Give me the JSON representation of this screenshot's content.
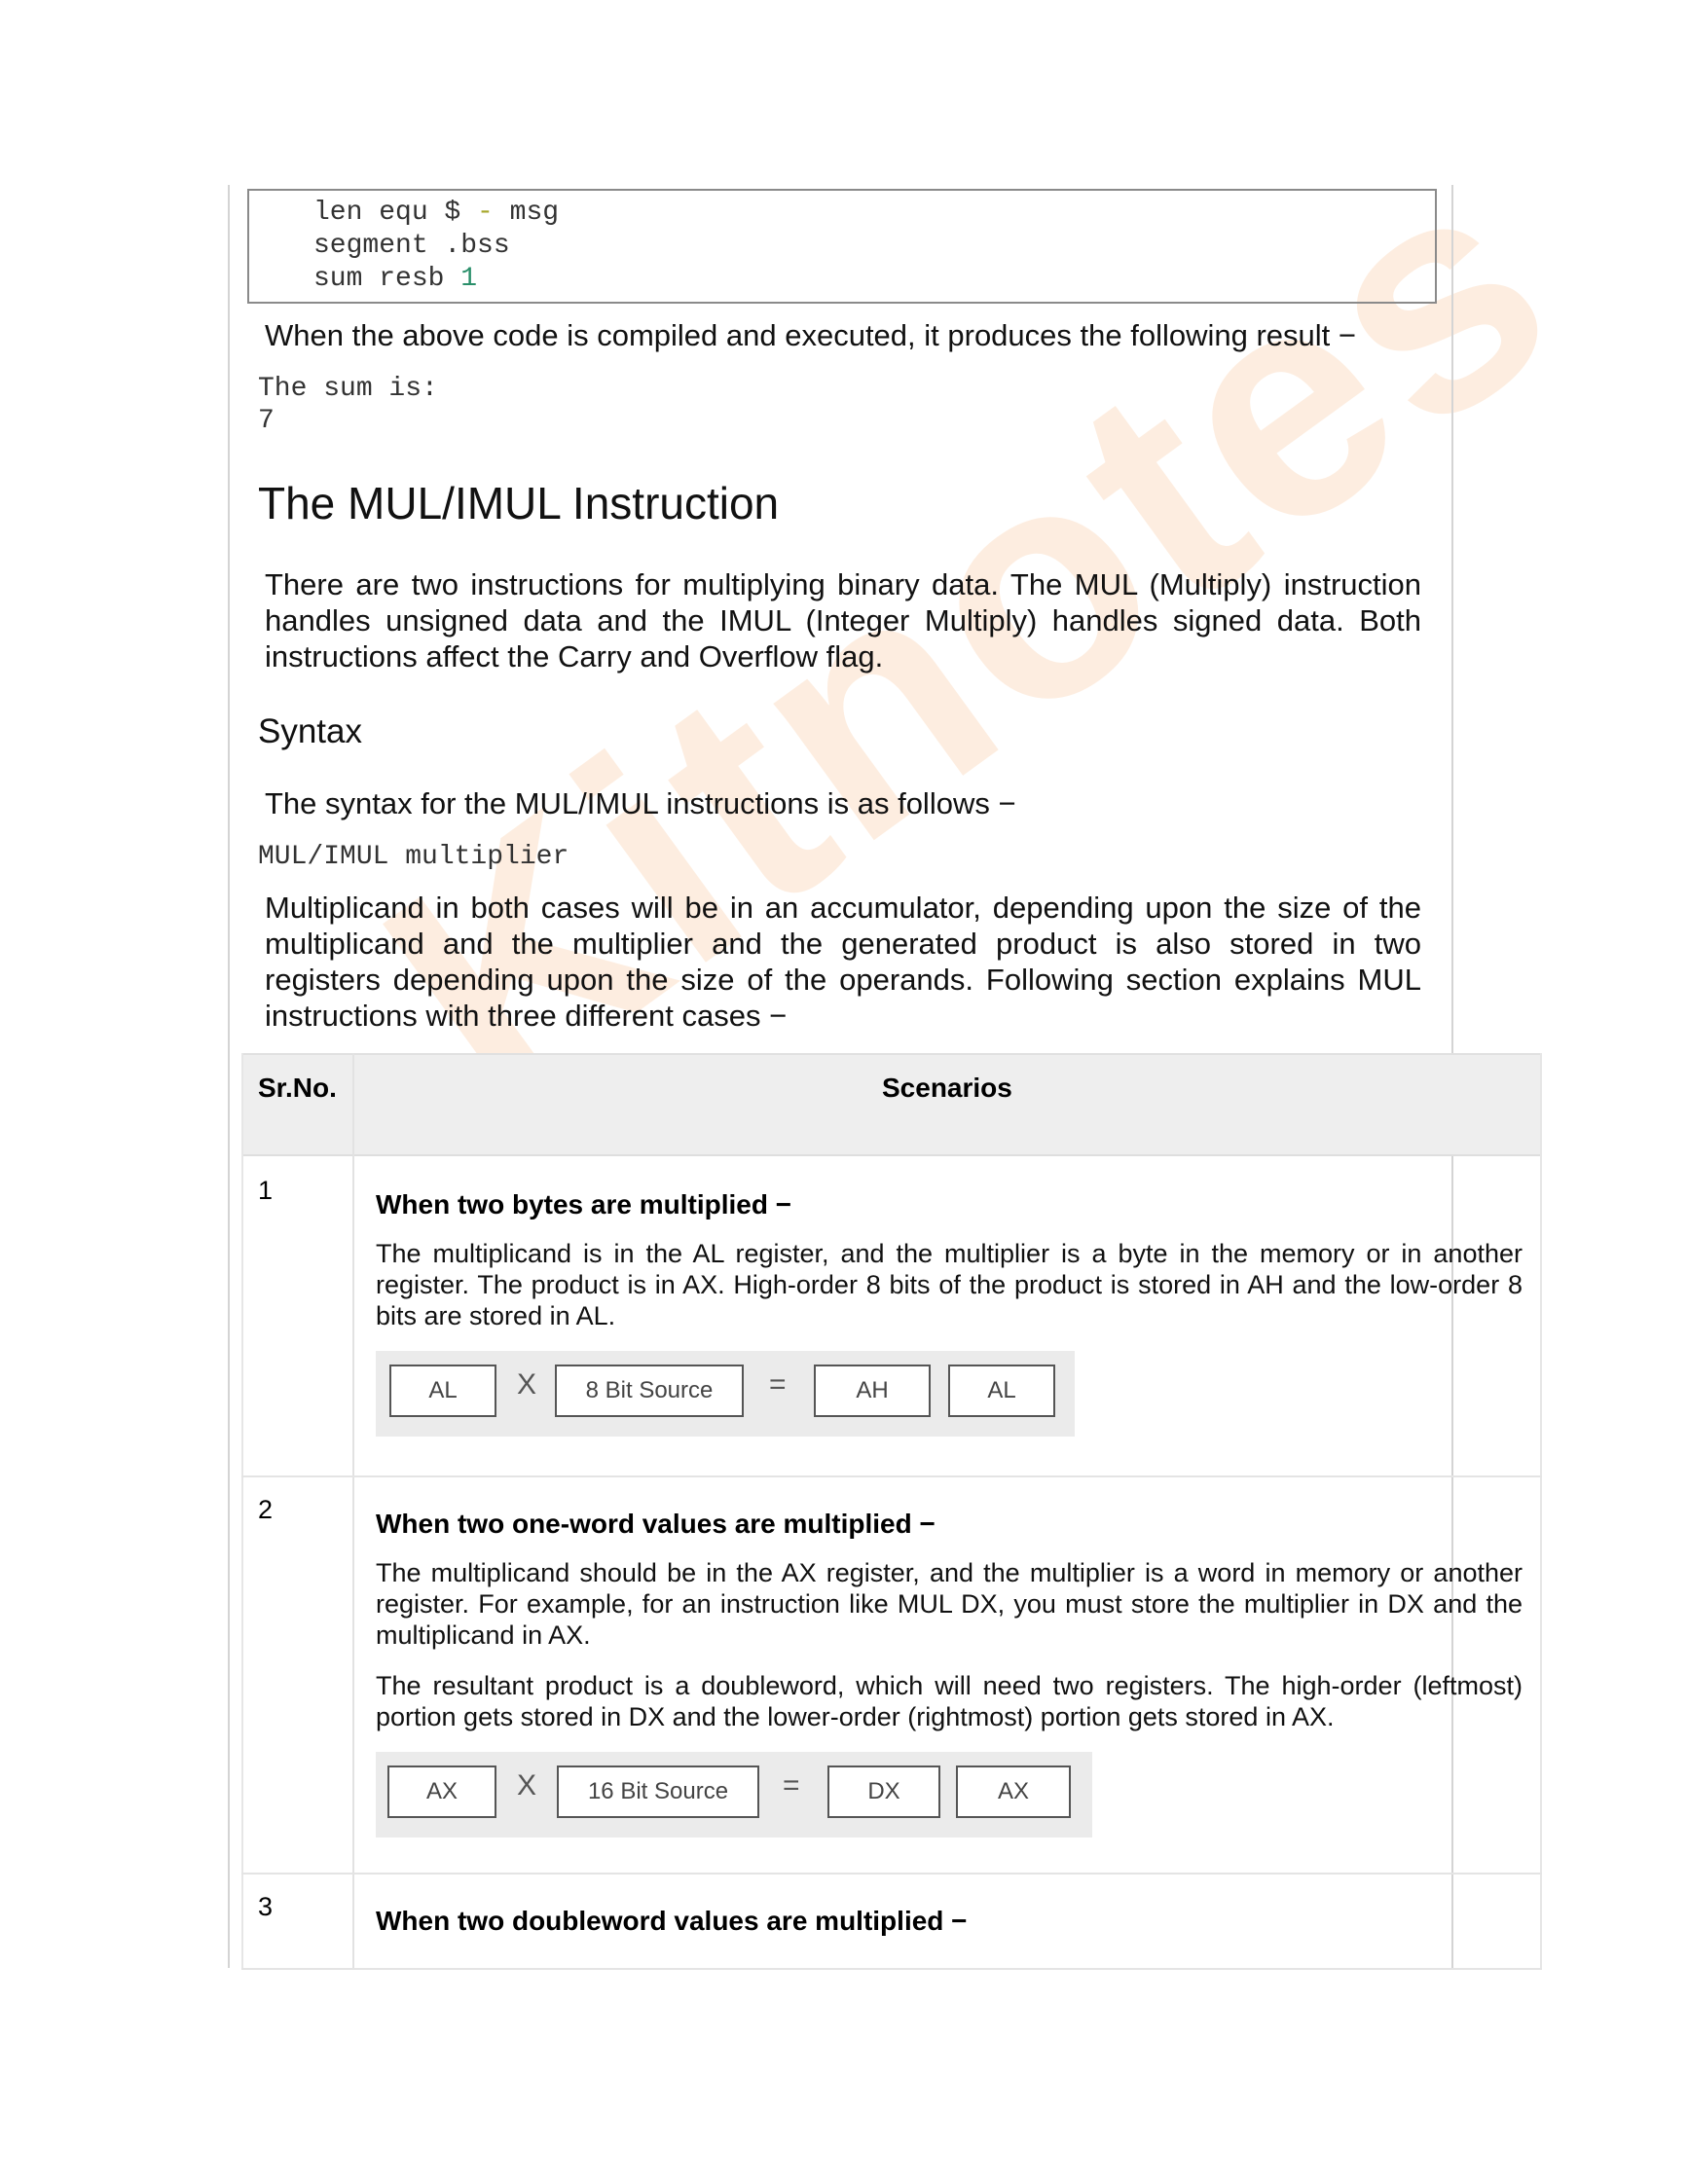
{
  "code_block": {
    "line1": {
      "a": "len equ $ ",
      "op": "-",
      "b": " msg"
    },
    "line2": "segment .bss",
    "line3": {
      "a": "sum resb ",
      "num": "1"
    }
  },
  "result_intro": "When the above code is compiled and executed, it produces the following result −",
  "output": {
    "line1": "The sum is:",
    "line2": "7"
  },
  "heading": "The MUL/IMUL Instruction",
  "intro_paragraph": "There are two instructions for multiplying binary data. The MUL (Multiply) instruction handles unsigned data and the IMUL (Integer Multiply) handles signed data. Both instructions affect the Carry and Overflow flag.",
  "syntax_heading": "Syntax",
  "syntax_intro": "The syntax for the MUL/IMUL instructions is as follows −",
  "syntax_code": "MUL/IMUL multiplier",
  "multiplicand_paragraph": "Multiplicand in both cases will be in an accumulator, depending upon the size of the multiplicand and the multiplier and the generated product is also stored in two registers depending upon the size of the operands. Following section explains MUL instructions with three different cases −",
  "table": {
    "headers": [
      "Sr.No.",
      "Scenarios"
    ],
    "rows": [
      {
        "num": "1",
        "title": "When two bytes are multiplied −",
        "text": "The multiplicand is in the AL register, and the multiplier is a byte in the memory or in another register. The product is in AX. High-order 8 bits of the product is stored in AH and the low-order 8 bits are stored in AL.",
        "diagram": {
          "a": "AL",
          "times": "X",
          "b": "8 Bit Source",
          "eq": "=",
          "c": "AH",
          "d": "AL"
        }
      },
      {
        "num": "2",
        "title": "When two one-word values are multiplied −",
        "text1": "The multiplicand should be in the AX register, and the multiplier is a word in memory or another register. For example, for an instruction like MUL DX, you must store the multiplier in DX and the multiplicand in AX.",
        "text2": "The resultant product is a doubleword, which will need two registers. The high-order (leftmost) portion gets stored in DX and the lower-order (rightmost) portion gets stored in AX.",
        "diagram": {
          "a": "AX",
          "times": "X",
          "b": "16 Bit Source",
          "eq": "=",
          "c": "DX",
          "d": "AX"
        }
      },
      {
        "num": "3",
        "title": "When two doubleword values are multiplied −"
      }
    ]
  },
  "watermark": "Kitnotes"
}
